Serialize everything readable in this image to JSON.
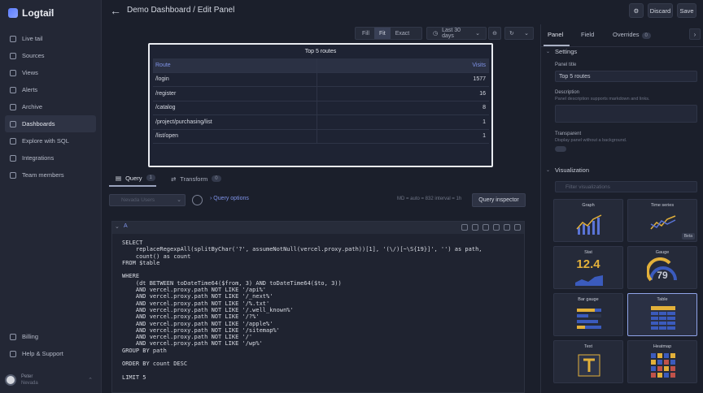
{
  "sidebar": {
    "brand": "Logtail",
    "items": [
      {
        "label": "Live tail",
        "icon": "live-tail-icon"
      },
      {
        "label": "Sources",
        "icon": "sources-icon"
      },
      {
        "label": "Views",
        "icon": "eye-icon"
      },
      {
        "label": "Alerts",
        "icon": "alert-icon"
      },
      {
        "label": "Archive",
        "icon": "archive-icon"
      },
      {
        "label": "Dashboards",
        "icon": "dashboard-icon",
        "active": true
      },
      {
        "label": "Explore with SQL",
        "icon": "code-icon"
      },
      {
        "label": "Integrations",
        "icon": "integrations-icon"
      },
      {
        "label": "Team members",
        "icon": "team-icon"
      }
    ],
    "bottom": [
      {
        "label": "Billing",
        "icon": "billing-icon"
      },
      {
        "label": "Help & Support",
        "icon": "help-icon"
      }
    ],
    "user": {
      "name": "Peter",
      "team": "Nevada"
    }
  },
  "header": {
    "title": "Demo Dashboard / Edit Panel",
    "discard": "Discard",
    "save": "Save"
  },
  "toolbar": {
    "fill": "Fill",
    "fit": "Fit",
    "exact": "Exact",
    "time_range": "Last 30 days"
  },
  "preview": {
    "title": "Top 5 routes",
    "columns": [
      "Route",
      "Visits"
    ],
    "rows": [
      [
        "/login",
        "1577"
      ],
      [
        "/register",
        "16"
      ],
      [
        "/catalog",
        "8"
      ],
      [
        "/project/purchasing/list",
        "1"
      ],
      [
        "/list/open",
        "1"
      ]
    ]
  },
  "query": {
    "tabs": [
      {
        "label": "Query",
        "count": "1"
      },
      {
        "label": "Transform",
        "count": "0"
      }
    ],
    "datasource": "Nevada Users",
    "options_label": "Query options",
    "info": "MD = auto = 832    interval = 1h",
    "inspector": "Query inspector",
    "ref": "A",
    "code": "SELECT\n    replaceRegexpAll(splitByChar('?', assumeNotNull(vercel.proxy.path))[1], '(\\/)[~\\S{19}]', '') as path,\n    count() as count\nFROM $table\n\nWHERE\n    (dt BETWEEN toDateTime64($from, 3) AND toDateTime64($to, 3))\n    AND vercel.proxy.path NOT LIKE '/api%'\n    AND vercel.proxy.path NOT LIKE '/_next%'\n    AND vercel.proxy.path NOT LIKE '/%.txt'\n    AND vercel.proxy.path NOT LIKE '/.well_known%'\n    AND vercel.proxy.path NOT LIKE '/?%'\n    AND vercel.proxy.path NOT LIKE '/apple%'\n    AND vercel.proxy.path NOT LIKE '/sitemap%'\n    AND vercel.proxy.path NOT LIKE '/'\n    AND vercel.proxy.path NOT LIKE '/wp%'\nGROUP BY path\n\nORDER BY count DESC\n\nLIMIT 5"
  },
  "right_panel": {
    "tabs": [
      "Panel",
      "Field",
      "Overrides"
    ],
    "overrides_count": "0",
    "settings": {
      "heading": "Settings",
      "panel_title_label": "Panel title",
      "panel_title_value": "Top 5 routes",
      "description_label": "Description",
      "description_hint": "Panel description supports markdown and links.",
      "transparent_label": "Transparent",
      "transparent_hint": "Display panel without a background."
    },
    "visualization": {
      "heading": "Visualization",
      "search_placeholder": "Filter visualizations",
      "cards": [
        {
          "name": "Graph"
        },
        {
          "name": "Time series",
          "badge": "Beta"
        },
        {
          "name": "Stat",
          "value": "12.4"
        },
        {
          "name": "Gauge",
          "value": "79"
        },
        {
          "name": "Bar gauge"
        },
        {
          "name": "Table",
          "selected": true
        },
        {
          "name": "Text"
        },
        {
          "name": "Heatmap"
        }
      ]
    }
  },
  "colors": {
    "accent": "#7f93e8",
    "bg": "#1b1f2b",
    "panel": "#1e2333"
  }
}
